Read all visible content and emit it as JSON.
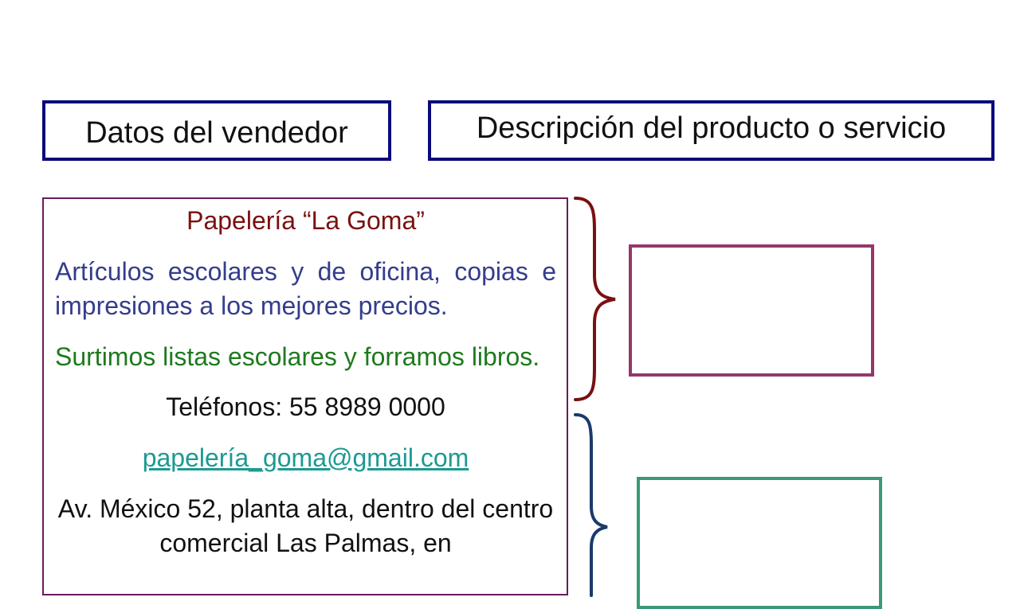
{
  "headers": {
    "seller": "Datos del vendedor",
    "description": "Descripción del producto o servicio"
  },
  "ad": {
    "shop_name": "Papelería “La Goma”",
    "products": "Artículos escolares y de oficina, copias e impresiones a los mejores precios.",
    "services": "Surtimos listas escolares y forramos libros.",
    "phones": "Teléfonos:  55 8989 0000",
    "email": "papelería_goma@gmail.com",
    "address": "Av. México 52, planta alta, dentro del centro comercial Las Palmas, en"
  },
  "colors": {
    "header_border": "#0a0a7a",
    "card_border": "#6a1b5a",
    "shop_name": "#7a1010",
    "products": "#343d8c",
    "services": "#1d7a1d",
    "email": "#1b9a92",
    "brace_top": "#7a1010",
    "brace_bottom": "#1a3a6a",
    "answer_box_1": "#93386b",
    "answer_box_2": "#3a9a74"
  }
}
